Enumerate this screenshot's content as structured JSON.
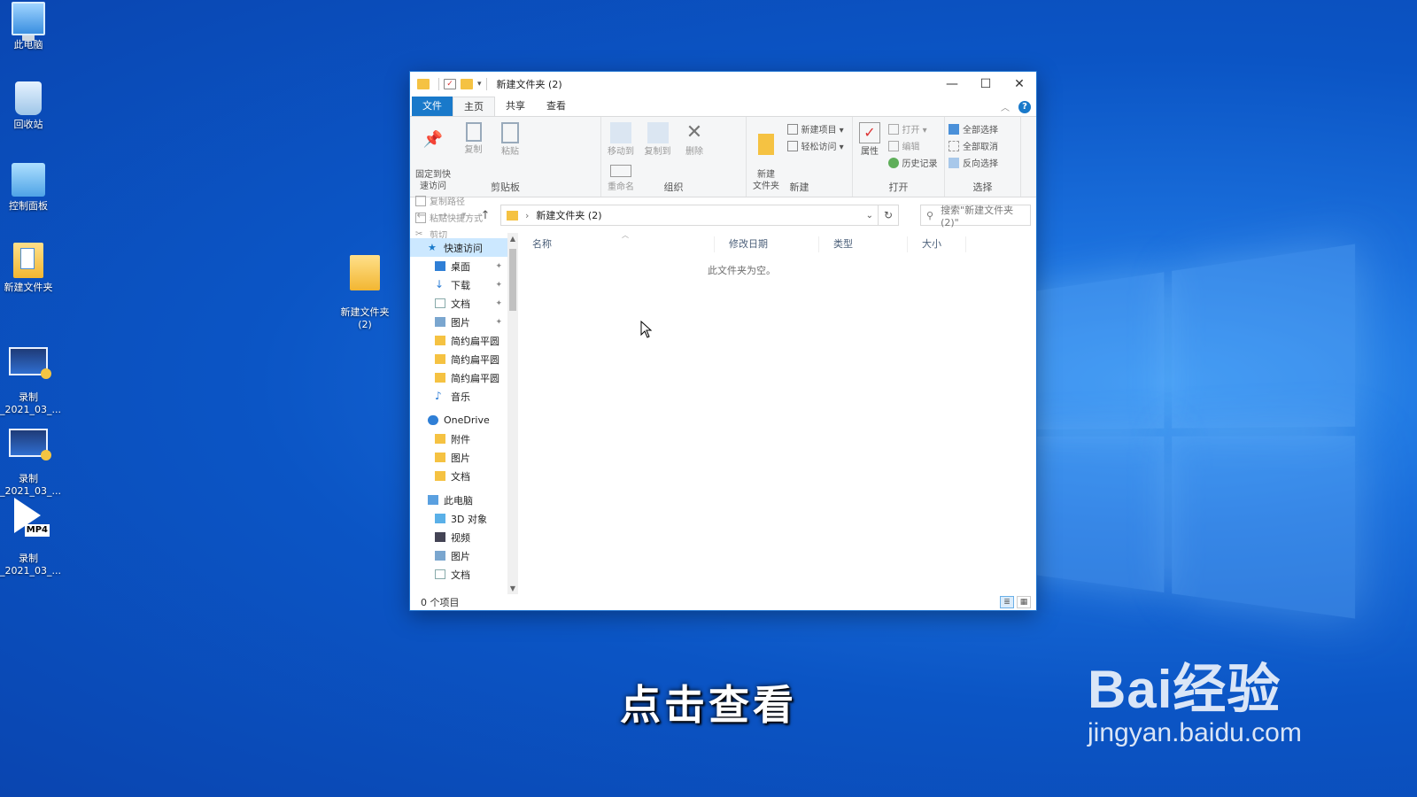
{
  "desktop": {
    "icons": [
      {
        "label": "此电脑"
      },
      {
        "label": "回收站"
      },
      {
        "label": "控制面板"
      },
      {
        "label": "新建文件夹"
      },
      {
        "label": "录制\n_2021_03_..."
      },
      {
        "label": "录制\n_2021_03_..."
      },
      {
        "label": "录制\n_2021_03_...",
        "badge": "MP4"
      },
      {
        "label": "新建文件夹\n(2)"
      }
    ]
  },
  "window": {
    "title": "新建文件夹 (2)",
    "controls": {
      "minimize": "—",
      "maximize": "☐",
      "close": "✕"
    },
    "menu": {
      "file": "文件",
      "home": "主页",
      "share": "共享",
      "view": "查看"
    },
    "ribbon": {
      "clipboard": {
        "label": "剪贴板",
        "pin": "固定到快\n速访问",
        "copy": "复制",
        "paste": "粘贴",
        "copy_path": "复制路径",
        "paste_shortcut": "粘贴快捷方式",
        "cut": "剪切"
      },
      "organize": {
        "label": "组织",
        "move_to": "移动到",
        "copy_to": "复制到",
        "delete": "删除",
        "rename": "重命名"
      },
      "new": {
        "label": "新建",
        "new_folder": "新建\n文件夹",
        "new_item": "新建项目 ▾",
        "easy_access": "轻松访问 ▾"
      },
      "open": {
        "label": "打开",
        "properties": "属性",
        "open": "打开 ▾",
        "edit": "编辑",
        "history": "历史记录"
      },
      "select": {
        "label": "选择",
        "select_all": "全部选择",
        "select_none": "全部取消",
        "invert": "反向选择"
      }
    },
    "address": {
      "path": "新建文件夹 (2)",
      "search_placeholder": "搜索\"新建文件夹 (2)\""
    },
    "nav": {
      "quick_access": "快速访问",
      "items_quick": [
        {
          "label": "桌面",
          "pinned": true
        },
        {
          "label": "下载",
          "pinned": true
        },
        {
          "label": "文档",
          "pinned": true
        },
        {
          "label": "图片",
          "pinned": true
        },
        {
          "label": "简约扁平圆"
        },
        {
          "label": "简约扁平圆"
        },
        {
          "label": "简约扁平圆"
        },
        {
          "label": "音乐"
        }
      ],
      "onedrive": "OneDrive",
      "items_onedrive": [
        {
          "label": "附件"
        },
        {
          "label": "图片"
        },
        {
          "label": "文档"
        }
      ],
      "this_pc": "此电脑",
      "items_pc": [
        {
          "label": "3D 对象"
        },
        {
          "label": "视频"
        },
        {
          "label": "图片"
        },
        {
          "label": "文档"
        }
      ]
    },
    "columns": {
      "name": "名称",
      "modified": "修改日期",
      "type": "类型",
      "size": "大小"
    },
    "empty_message": "此文件夹为空。",
    "status": "0 个项目"
  },
  "caption": "点击查看",
  "watermark": {
    "brand": "Bai经验",
    "url": "jingyan.baidu.com"
  },
  "colors": {
    "accent": "#1979ca",
    "desktop": "#0b55c5",
    "folder": "#f5c242"
  }
}
